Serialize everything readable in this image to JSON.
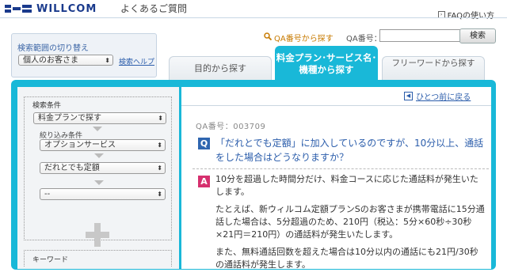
{
  "header": {
    "logo_text": "WILLCOM",
    "page_title": "よくあるご質問",
    "faq_help": "FAQの使い方"
  },
  "search": {
    "qa_number_search_link": "QA番号から探す",
    "qa_number_label": "QA番号：",
    "qa_number_value": "",
    "search_button": "検索"
  },
  "scope": {
    "title": "検索範囲の切り替え",
    "selected": "個人のお客さま",
    "help_link": "検索ヘルプ"
  },
  "tabs": [
    {
      "label": "目的から探す",
      "active": false
    },
    {
      "label": "料金プラン･サービス名･機種から探す",
      "active": true
    },
    {
      "label": "フリーワードから探す",
      "active": false
    }
  ],
  "conditions": {
    "title": "検索条件",
    "main_select": "料金プランで探す",
    "narrow_label": "絞り込み条件",
    "filter1": "オプションサービス",
    "filter2": "だれとでも定額",
    "filter3": "--",
    "keyword_title": "キーワード"
  },
  "content": {
    "back_link": "ひとつ前に戻る",
    "qa_number": "QA番号：003709",
    "q_badge": "Q",
    "question": "「だれとでも定額」に加入しているのですが、10分以上、通話をした場合はどうなりますか？",
    "a_badge": "A",
    "answer_paragraphs": [
      "10分を超過した時間分だけ、料金コースに応じた通話料が発生いたします。",
      "たとえば、新ウィルコム定額プランSのお客さまが携帯電話に15分通話した場合は、5分超過のため、210円（税込：5分×60秒÷30秒×21円＝210円）の通話料が発生いたします。",
      "また、無料通話回数を超えた場合は10分以内の通話にも21円/30秒の通話料が発生します。"
    ]
  }
}
